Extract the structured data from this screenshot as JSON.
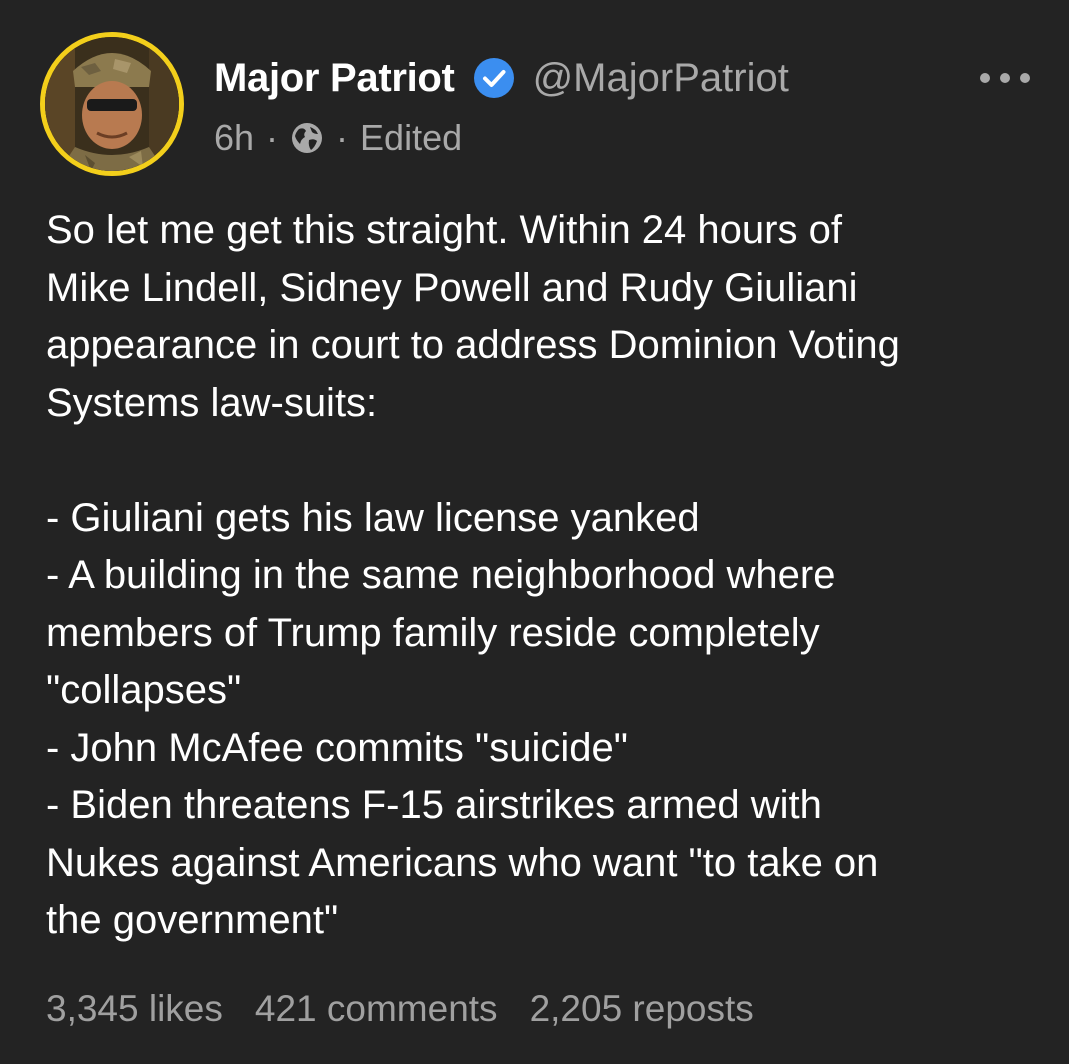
{
  "author": {
    "display_name": "Major Patriot",
    "handle": "@MajorPatriot",
    "verified_icon": "verified-check-icon",
    "avatar_ring_color": "#f3cf1b",
    "verified_color": "#3b8ef0"
  },
  "meta": {
    "time": "6h",
    "dot1": "·",
    "visibility_icon": "globe-icon",
    "dot2": "·",
    "edited": "Edited"
  },
  "more_icon": "more-options-icon",
  "post": {
    "lines": [
      "So let me get this straight. Within 24 hours of",
      "Mike Lindell, Sidney Powell and Rudy Giuliani",
      "appearance in court to address Dominion Voting",
      "Systems law-suits:",
      "",
      "- Giuliani gets his law license yanked",
      "- A building in the same neighborhood where",
      "members of Trump family reside completely",
      "\"collapses\"",
      "- John McAfee commits \"suicide\"",
      "- Biden threatens F-15 airstrikes armed with",
      "Nukes against Americans who want \"to take on",
      "the government\""
    ]
  },
  "stats": {
    "likes": "3,345 likes",
    "comments": "421 comments",
    "reposts": "2,205 reposts"
  }
}
